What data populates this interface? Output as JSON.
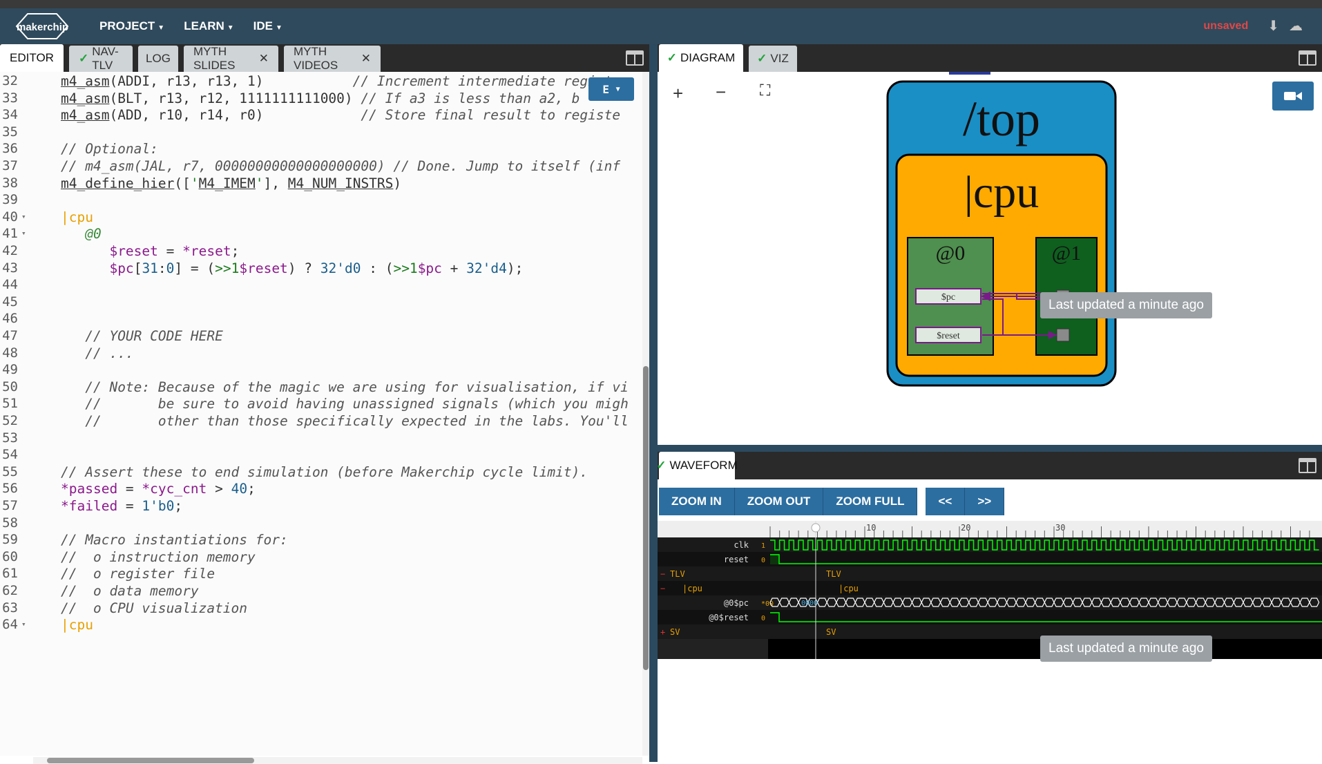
{
  "app": {
    "logo_text": "makerchip",
    "menu": [
      {
        "label": "PROJECT"
      },
      {
        "label": "LEARN"
      },
      {
        "label": "IDE"
      }
    ],
    "unsaved_label": "unsaved",
    "icons": [
      "download-icon",
      "cloud-upload-icon"
    ]
  },
  "left_tabs": [
    {
      "label": "EDITOR",
      "active": true
    },
    {
      "label": "NAV-TLV",
      "check": true
    },
    {
      "label": "LOG"
    },
    {
      "label": "MYTH SLIDES",
      "closable": true
    },
    {
      "label": "MYTH VIDEOS",
      "closable": true
    }
  ],
  "editor": {
    "mode_button": "E",
    "lines": [
      {
        "n": "32",
        "html": "<span class='ul'>m4_asm</span>(ADDI, r13, r13, 1)           <span class='cm'>// Increment intermediate regist</span>"
      },
      {
        "n": "33",
        "html": "<span class='ul'>m4_asm</span>(BLT, r13, r12, 1111111111000) <span class='cm'>// If a3 is less than a2, b</span>"
      },
      {
        "n": "34",
        "html": "<span class='ul'>m4_asm</span>(ADD, r10, r14, r0)            <span class='cm'>// Store final result to registe</span>"
      },
      {
        "n": "35",
        "html": ""
      },
      {
        "n": "36",
        "html": "<span class='cm'>// Optional:</span>"
      },
      {
        "n": "37",
        "html": "<span class='cm'>// m4_asm(JAL, r7, 00000000000000000000) // Done. Jump to itself (inf</span>"
      },
      {
        "n": "38",
        "html": "<span class='ul'>m4_define_hier</span>([<span class='str'>'</span><span class='ul'>M4_IMEM</span><span class='str'>'</span>], <span class='ul'>M4_NUM_INSTRS</span>)"
      },
      {
        "n": "39",
        "html": ""
      },
      {
        "n": "40",
        "fold": true,
        "html": "<span class='pipe'>|cpu</span>"
      },
      {
        "n": "41",
        "fold": true,
        "html": "   <span class='stage'>@0</span>"
      },
      {
        "n": "42",
        "html": "      <span class='sig'>$reset</span> = <span class='sig'>*reset</span>;"
      },
      {
        "n": "43",
        "html": "      <span class='sig'>$pc</span>[<span class='num'>31</span>:<span class='num'>0</span>] = (<span class='str'>&gt;&gt;1</span><span class='sig'>$reset</span>) ? <span class='num'>32'd0</span> : (<span class='str'>&gt;&gt;1</span><span class='sig'>$pc</span> + <span class='num'>32'd4</span>);"
      },
      {
        "n": "44",
        "html": ""
      },
      {
        "n": "45",
        "html": ""
      },
      {
        "n": "46",
        "html": ""
      },
      {
        "n": "47",
        "html": "   <span class='cm'>// YOUR CODE HERE</span>"
      },
      {
        "n": "48",
        "html": "   <span class='cm'>// ...</span>"
      },
      {
        "n": "49",
        "html": ""
      },
      {
        "n": "50",
        "html": "   <span class='cm'>// Note: Because of the magic we are using for visualisation, if vi</span>"
      },
      {
        "n": "51",
        "html": "   <span class='cm'>//       be sure to avoid having unassigned signals (which you migh</span>"
      },
      {
        "n": "52",
        "html": "   <span class='cm'>//       other than those specifically expected in the labs. You'll</span>"
      },
      {
        "n": "53",
        "html": ""
      },
      {
        "n": "54",
        "html": ""
      },
      {
        "n": "55",
        "html": "<span class='cm'>// Assert these to end simulation (before Makerchip cycle limit).</span>"
      },
      {
        "n": "56",
        "html": "<span class='sig'>*passed</span> = <span class='sig'>*cyc_cnt</span> &gt; <span class='num'>40</span>;"
      },
      {
        "n": "57",
        "html": "<span class='sig'>*failed</span> = <span class='num'>1'b0</span>;"
      },
      {
        "n": "58",
        "html": ""
      },
      {
        "n": "59",
        "html": "<span class='cm'>// Macro instantiations for:</span>"
      },
      {
        "n": "60",
        "html": "<span class='cm'>//  o instruction memory</span>"
      },
      {
        "n": "61",
        "html": "<span class='cm'>//  o register file</span>"
      },
      {
        "n": "62",
        "html": "<span class='cm'>//  o data memory</span>"
      },
      {
        "n": "63",
        "html": "<span class='cm'>//  o CPU visualization</span>"
      },
      {
        "n": "64",
        "fold": true,
        "html": "<span class='pipe'>|cpu</span>"
      }
    ]
  },
  "right_tabs": [
    {
      "label": "DIAGRAM",
      "check": true,
      "active": true
    },
    {
      "label": "VIZ",
      "check": true
    }
  ],
  "diagram": {
    "zoom_in": "+",
    "zoom_out": "−",
    "fit": "⛶",
    "top_label": "/top",
    "cpu_label": "|cpu",
    "stage0_label": "@0",
    "stage1_label": "@1",
    "sig_pc": "$pc",
    "sig_reset": "$reset",
    "updated": "Last updated a minute ago",
    "colors": {
      "top": "#1a8fc6",
      "cpu": "#ffaa00",
      "stage0": "#4f8f4f",
      "stage1": "#0f5f1f",
      "wire": "#7a1a8a"
    }
  },
  "waveform": {
    "tab_label": "WAVEFORM",
    "buttons": [
      "ZOOM IN",
      "ZOOM OUT",
      "ZOOM FULL"
    ],
    "nav_buttons": [
      "<<",
      ">>"
    ],
    "ticks": [
      "10",
      "20",
      "30"
    ],
    "rows": [
      {
        "name": "clk",
        "val": "1"
      },
      {
        "name": "reset",
        "val": "0"
      },
      {
        "name": "TLV",
        "section": true
      },
      {
        "name": "|cpu",
        "section": true
      },
      {
        "name": "@0$pc",
        "val": "*00"
      },
      {
        "name": "@0$reset",
        "val": "0"
      },
      {
        "name": "SV",
        "section": true
      }
    ],
    "pc_sample": "0000",
    "updated": "Last updated a minute ago"
  }
}
